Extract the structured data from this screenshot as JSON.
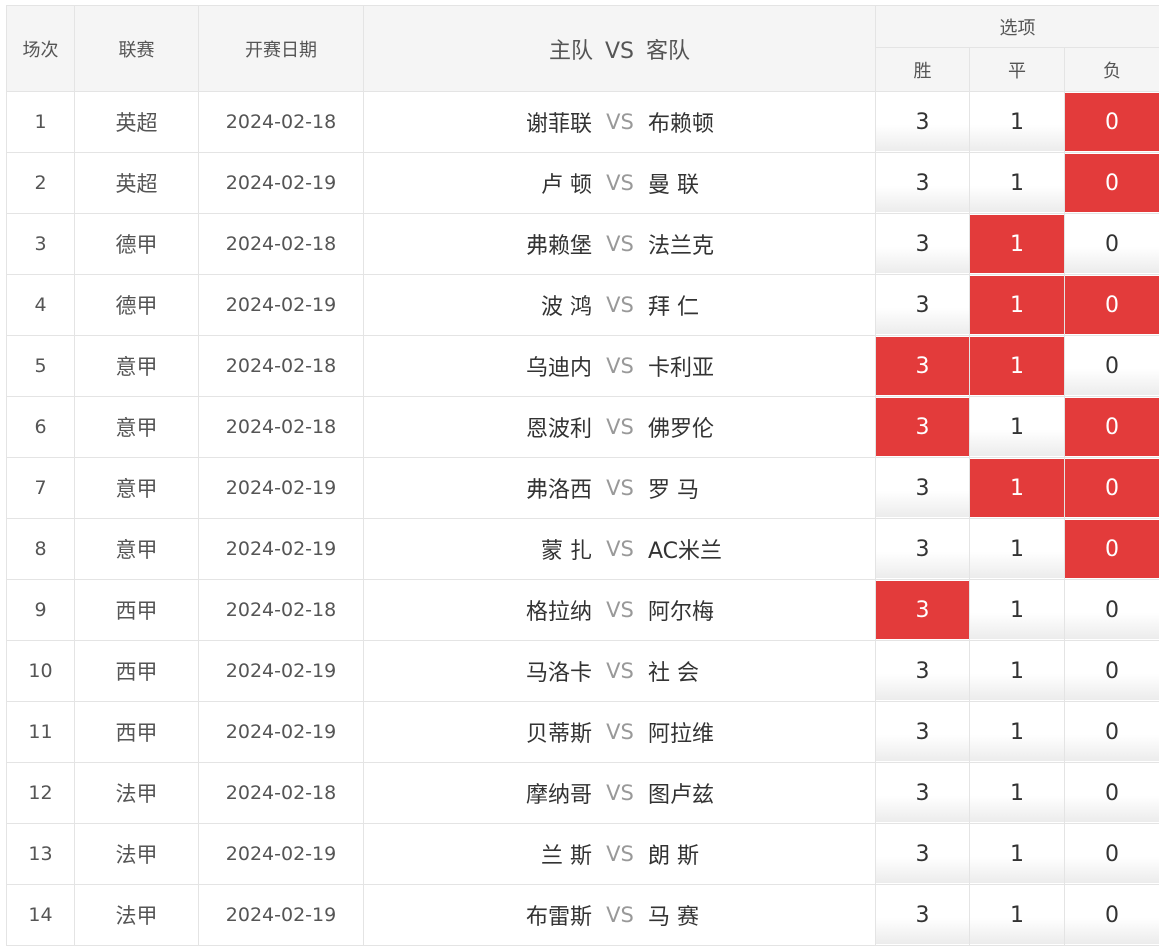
{
  "header": {
    "no": "场次",
    "league": "联赛",
    "date": "开赛日期",
    "home": "主队",
    "vs": "VS",
    "away": "客队",
    "options": "选项",
    "win": "胜",
    "draw": "平",
    "lose": "负"
  },
  "vs_label": "VS",
  "selected_color": "#e33b3b",
  "rows": [
    {
      "no": "1",
      "league": "英超",
      "date": "2024-02-18",
      "home": "谢菲联",
      "away": "布赖顿",
      "win": "3",
      "draw": "1",
      "lose": "0",
      "sel": {
        "win": false,
        "draw": false,
        "lose": true
      }
    },
    {
      "no": "2",
      "league": "英超",
      "date": "2024-02-19",
      "home": "卢 顿",
      "away": "曼 联",
      "win": "3",
      "draw": "1",
      "lose": "0",
      "sel": {
        "win": false,
        "draw": false,
        "lose": true
      }
    },
    {
      "no": "3",
      "league": "德甲",
      "date": "2024-02-18",
      "home": "弗赖堡",
      "away": "法兰克",
      "win": "3",
      "draw": "1",
      "lose": "0",
      "sel": {
        "win": false,
        "draw": true,
        "lose": false
      }
    },
    {
      "no": "4",
      "league": "德甲",
      "date": "2024-02-19",
      "home": "波 鸿",
      "away": "拜 仁",
      "win": "3",
      "draw": "1",
      "lose": "0",
      "sel": {
        "win": false,
        "draw": true,
        "lose": true
      }
    },
    {
      "no": "5",
      "league": "意甲",
      "date": "2024-02-18",
      "home": "乌迪内",
      "away": "卡利亚",
      "win": "3",
      "draw": "1",
      "lose": "0",
      "sel": {
        "win": true,
        "draw": true,
        "lose": false
      }
    },
    {
      "no": "6",
      "league": "意甲",
      "date": "2024-02-18",
      "home": "恩波利",
      "away": "佛罗伦",
      "win": "3",
      "draw": "1",
      "lose": "0",
      "sel": {
        "win": true,
        "draw": false,
        "lose": true
      }
    },
    {
      "no": "7",
      "league": "意甲",
      "date": "2024-02-19",
      "home": "弗洛西",
      "away": "罗 马",
      "win": "3",
      "draw": "1",
      "lose": "0",
      "sel": {
        "win": false,
        "draw": true,
        "lose": true
      }
    },
    {
      "no": "8",
      "league": "意甲",
      "date": "2024-02-19",
      "home": "蒙 扎",
      "away": "AC米兰",
      "win": "3",
      "draw": "1",
      "lose": "0",
      "sel": {
        "win": false,
        "draw": false,
        "lose": true
      }
    },
    {
      "no": "9",
      "league": "西甲",
      "date": "2024-02-18",
      "home": "格拉纳",
      "away": "阿尔梅",
      "win": "3",
      "draw": "1",
      "lose": "0",
      "sel": {
        "win": true,
        "draw": false,
        "lose": false
      }
    },
    {
      "no": "10",
      "league": "西甲",
      "date": "2024-02-19",
      "home": "马洛卡",
      "away": "社 会",
      "win": "3",
      "draw": "1",
      "lose": "0",
      "sel": {
        "win": false,
        "draw": false,
        "lose": false
      }
    },
    {
      "no": "11",
      "league": "西甲",
      "date": "2024-02-19",
      "home": "贝蒂斯",
      "away": "阿拉维",
      "win": "3",
      "draw": "1",
      "lose": "0",
      "sel": {
        "win": false,
        "draw": false,
        "lose": false
      }
    },
    {
      "no": "12",
      "league": "法甲",
      "date": "2024-02-18",
      "home": "摩纳哥",
      "away": "图卢兹",
      "win": "3",
      "draw": "1",
      "lose": "0",
      "sel": {
        "win": false,
        "draw": false,
        "lose": false
      }
    },
    {
      "no": "13",
      "league": "法甲",
      "date": "2024-02-19",
      "home": "兰 斯",
      "away": "朗 斯",
      "win": "3",
      "draw": "1",
      "lose": "0",
      "sel": {
        "win": false,
        "draw": false,
        "lose": false
      }
    },
    {
      "no": "14",
      "league": "法甲",
      "date": "2024-02-19",
      "home": "布雷斯",
      "away": "马 赛",
      "win": "3",
      "draw": "1",
      "lose": "0",
      "sel": {
        "win": false,
        "draw": false,
        "lose": false
      }
    }
  ]
}
